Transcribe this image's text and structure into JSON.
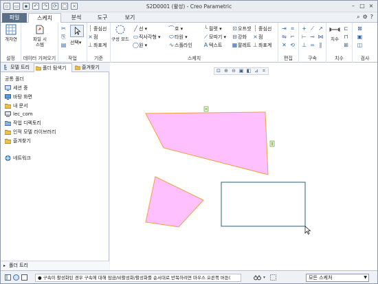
{
  "window": {
    "title": "S2D0001 (활성) - Creo Parametric"
  },
  "tabs": {
    "file": "파일",
    "sketch": "스케치",
    "analysis": "분석",
    "tools": "도구",
    "view": "보기"
  },
  "ribbon": {
    "setup": {
      "label": "설정",
      "sketch_settings": "개자연"
    },
    "data": {
      "label": "데이터 가져오기",
      "import": "파일 시\n스템"
    },
    "operations": {
      "label": "작업",
      "select": "선택",
      "select_dd": "▾"
    },
    "datum": {
      "label": "기준",
      "centerline": "중심선",
      "point": "점",
      "csys": "좌표계"
    },
    "sketching": {
      "label": "스케치",
      "construction": "구성 모드",
      "line": "선",
      "rectangle": "직사각형",
      "circle": "원",
      "arc": "호",
      "ellipse": "타원",
      "spline": "스플라인",
      "fillet": "필렛",
      "chamfer": "모따기",
      "text": "텍스트",
      "offset": "오프셋",
      "thicken": "강화",
      "palette": "팔레트",
      "centerline2": "중심선",
      "point2": "점",
      "csys2": "좌표계"
    },
    "editing": {
      "label": "편집"
    },
    "constrain": {
      "label": "구속"
    },
    "dimension": {
      "label": "치수",
      "dim": "치수"
    },
    "inspect": {
      "label": "검사"
    }
  },
  "panel": {
    "tabs": {
      "model_tree": "모델 트리",
      "folder_browser": "폴더 탐색기",
      "favorites": "즐겨찾기"
    },
    "title": "공통 폴더",
    "folders": [
      "세션 중",
      "바탕 화면",
      "내 문서",
      "lec_com",
      "작업 디렉토리",
      "인적 모델 라이브러리",
      "즐겨찾기"
    ],
    "network": "네트워크",
    "model_tree": "폴더 트리"
  },
  "status": {
    "message": "● 구속이 활성화된 경우 구속에 대해 잠금/비활성화/활성화를 순서대로 반복하려면 마우스 오른쪽 버튼(",
    "filter": "모든 스케처"
  },
  "colors": {
    "shape_fill": "#ffc0ff",
    "shape_stroke": "#f2a03c",
    "rect_stroke": "#2a5d78",
    "accent": "#2f63a8"
  }
}
